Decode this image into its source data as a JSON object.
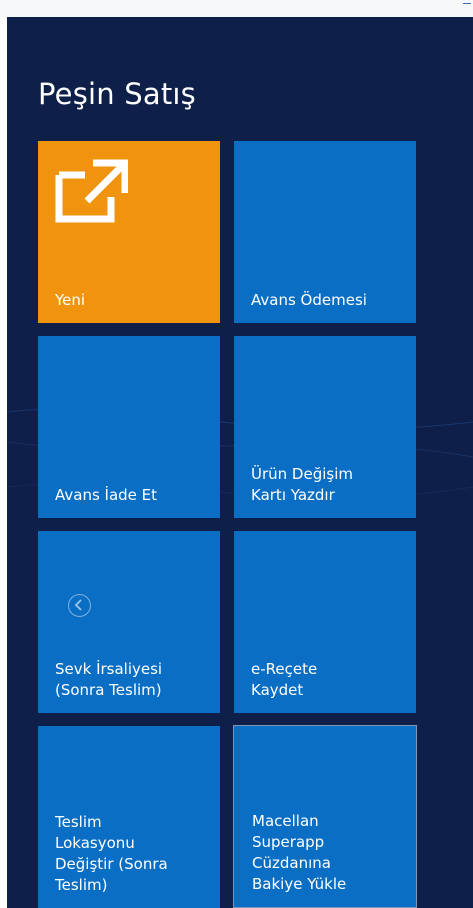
{
  "page": {
    "title": "Peşin Satış"
  },
  "colors": {
    "background": "#0e1f4a",
    "tile": "#0a6fc4",
    "tile_accent": "#f0930f",
    "text": "#ffffff"
  },
  "tiles": [
    {
      "label": "Yeni",
      "icon": "open-external-icon",
      "accent": true
    },
    {
      "label": "Avans Ödemesi"
    },
    {
      "label": "Avans İade Et"
    },
    {
      "label": "Ürün Değişim\nKartı Yazdır"
    },
    {
      "label": "Sevk İrsaliyesi\n(Sonra Teslim)",
      "icon": "back-arrow-icon"
    },
    {
      "label": "e-Reçete\nKaydet"
    },
    {
      "label": "Teslim\nLokasyonu\nDeğiştir (Sonra\nTeslim)"
    },
    {
      "label": "Macellan\nSuperapp\nCüzdanına\nBakiye Yükle",
      "selected": true
    }
  ]
}
